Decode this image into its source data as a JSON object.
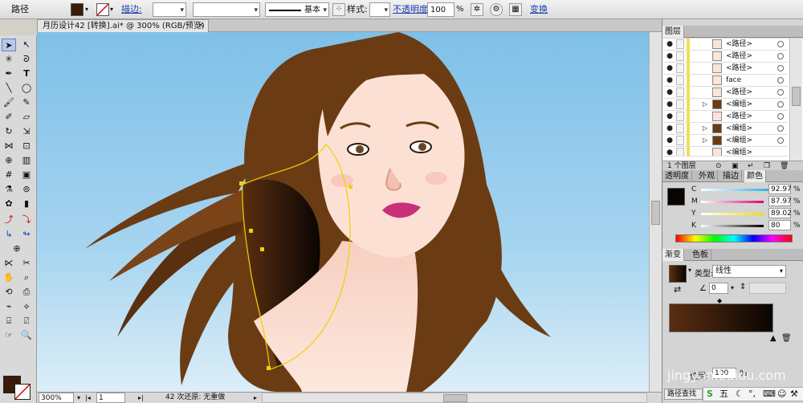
{
  "control_bar": {
    "object_type": "路径",
    "stroke_label": "描边:",
    "stroke_style": "基本",
    "style_label": "样式:",
    "opacity_label": "不透明度:",
    "opacity_value": "100",
    "opacity_unit": "%",
    "transform_label": "变换",
    "fill_color": "#3a1a08"
  },
  "document": {
    "tab_title": "月历设计42 [转换].ai* @ 300% (RGB/预览)",
    "close_glyph": "×"
  },
  "status_bar": {
    "zoom": "300%",
    "artboard": "1",
    "undo_info": "42 次还原: 无重做"
  },
  "layers_panel": {
    "title": "图层",
    "layer_count": "1 个图层",
    "items": [
      {
        "label": "<路径>"
      },
      {
        "label": "<路径>"
      },
      {
        "label": "<路径>"
      },
      {
        "label": "face"
      },
      {
        "label": "<路径>"
      },
      {
        "label": "<编组>"
      },
      {
        "label": "<路径>"
      },
      {
        "label": "<编组>"
      },
      {
        "label": "<编组>"
      },
      {
        "label": "<编组>"
      }
    ]
  },
  "color_panel": {
    "tabs": [
      "透明度",
      "外观",
      "描边",
      "颜色"
    ],
    "channels": [
      {
        "name": "C",
        "value": "92.97"
      },
      {
        "name": "M",
        "value": "87.97"
      },
      {
        "name": "Y",
        "value": "89.02"
      },
      {
        "name": "K",
        "value": "80"
      }
    ],
    "unit": "%"
  },
  "gradient_panel": {
    "tabs": [
      "渐变",
      "色板"
    ],
    "type_label": "类型:",
    "type_value": "线性",
    "angle_value": "0",
    "location_label": "位置:",
    "location_value": "100",
    "location_unit": "%",
    "start_color": "#5a2e10",
    "end_color": "#0a0502"
  },
  "bottom_panel": {
    "find_path_label": "路径查找"
  },
  "watermark": "jingyan.baidu.com",
  "ime_bar": {
    "mode": "五"
  },
  "colors": {
    "hair": "#6b3c14",
    "skin": "#fde0d4",
    "sky_top": "#7fc0e8",
    "selection": "#f0d000"
  }
}
